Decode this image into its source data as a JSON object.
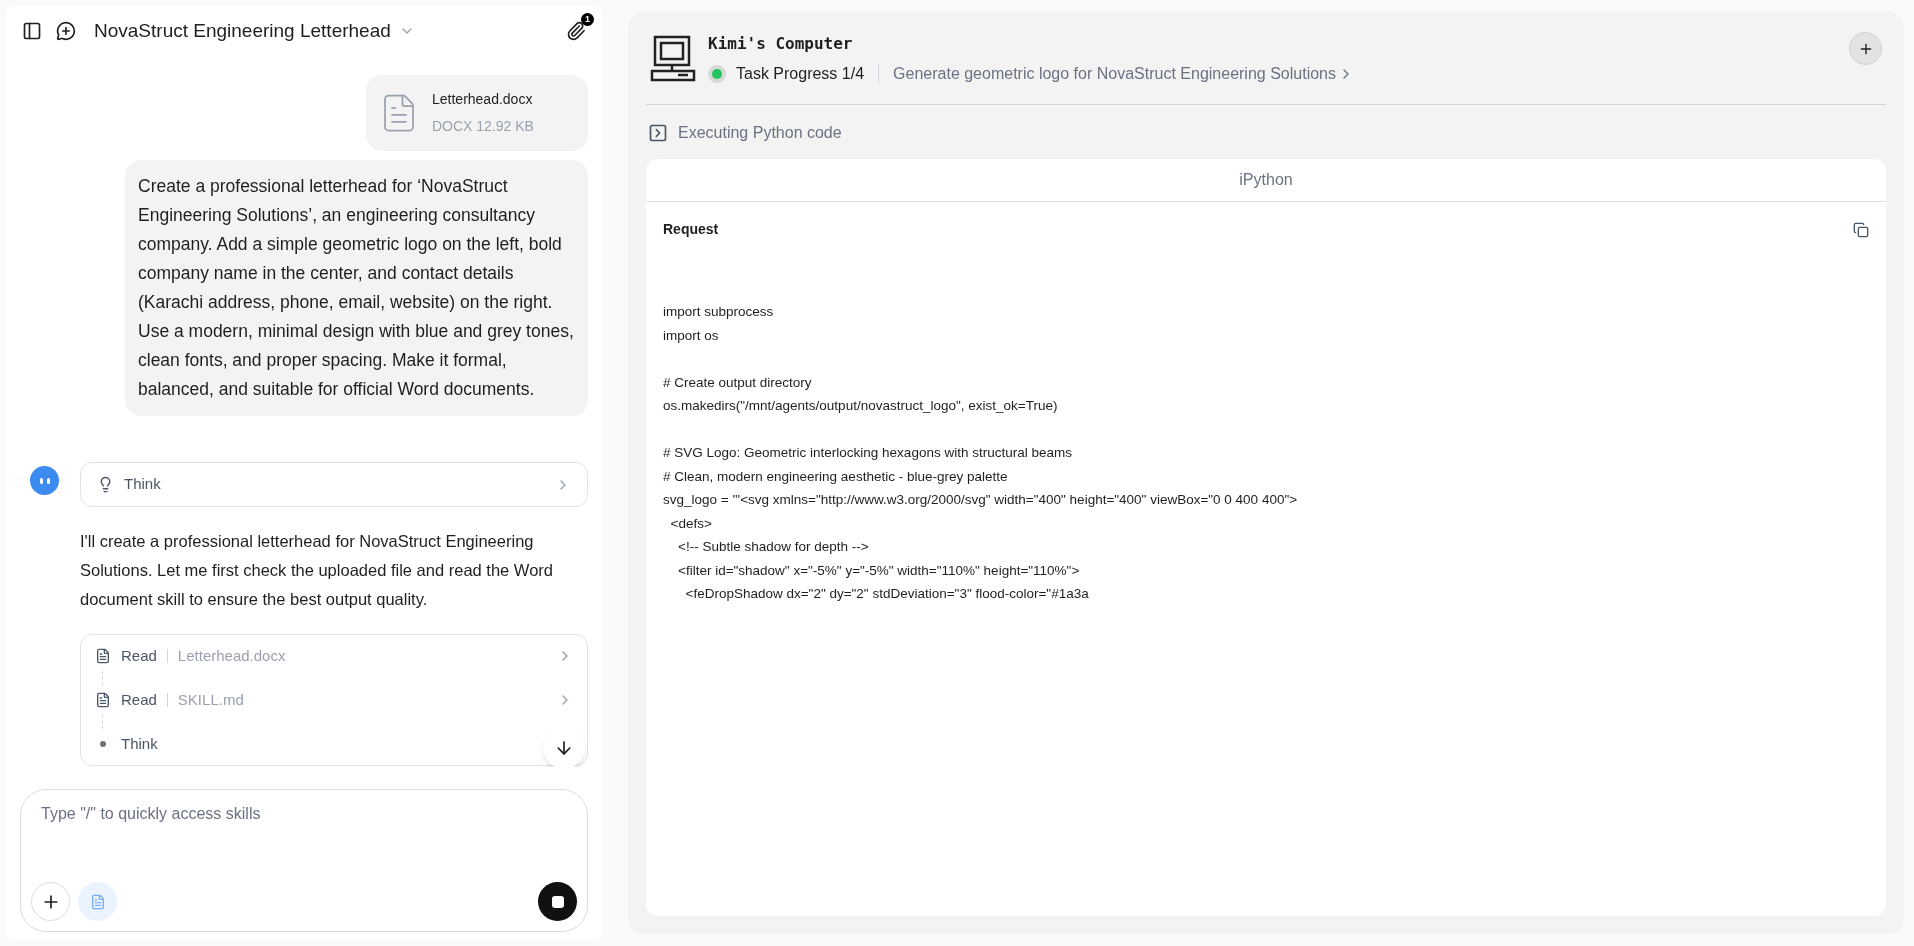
{
  "chat": {
    "title": "NovaStruct Engineering Letterhead",
    "attachment_count": "1",
    "attachment": {
      "name": "Letterhead.docx",
      "meta": "DOCX 12.92 KB"
    },
    "user_message": "Create a professional letterhead for ‘NovaStruct Engineering Solutions’, an engineering consultancy company. Add a simple geometric logo on the left, bold company name in the center, and contact details (Karachi address, phone, email, website) on the right. Use a modern, minimal design with blue and grey tones, clean fonts, and proper spacing. Make it formal, balanced, and suitable for official Word documents.",
    "think": {
      "label": "Think",
      "expanded": false
    },
    "reply": "I'll create a professional letterhead for NovaStruct Engineering Solutions. Let me first check the uploaded file and read the Word document skill to ensure the best output quality.",
    "steps": [
      {
        "kind": "read",
        "action": "Read",
        "target": "Letterhead.docx"
      },
      {
        "kind": "read",
        "action": "Read",
        "target": "SKILL.md"
      },
      {
        "kind": "think",
        "action": "Think"
      }
    ],
    "input": {
      "placeholder": "Type \"/\" to quickly access skills"
    }
  },
  "computer": {
    "title": "Kimi's Computer",
    "progress": "Task Progress 1/4",
    "running": true,
    "task": "Generate geometric logo for NovaStruct Engineering Solutions",
    "status": "Executing Python code",
    "panel": {
      "title": "iPython",
      "section": "Request",
      "code": "import subprocess\nimport os\n\n# Create output directory\nos.makedirs(\"/mnt/agents/output/novastruct_logo\", exist_ok=True)\n\n# SVG Logo: Geometric interlocking hexagons with structural beams\n# Clean, modern engineering aesthetic - blue-grey palette\nsvg_logo = '''<svg xmlns=\"http://www.w3.org/2000/svg\" width=\"400\" height=\"400\" viewBox=\"0 0 400 400\">\n  <defs>\n    <!-- Subtle shadow for depth -->\n    <filter id=\"shadow\" x=\"-5%\" y=\"-5%\" width=\"110%\" height=\"110%\">\n      <feDropShadow dx=\"2\" dy=\"2\" stdDeviation=\"3\" flood-color=\"#1a3a"
    }
  }
}
